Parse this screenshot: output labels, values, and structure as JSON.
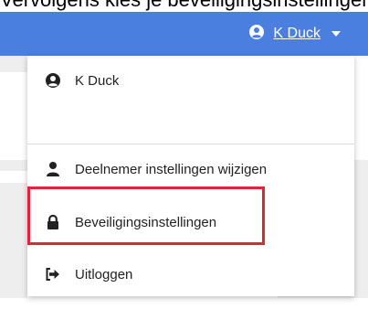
{
  "caption": "Vervolgens kies je beveiligingsinstellingen",
  "header": {
    "user_icon": "user-circle-icon",
    "user_name": "K Duck",
    "dropdown_icon": "caret-down-icon"
  },
  "menu": {
    "profile": {
      "icon": "user-circle-icon",
      "label": "K Duck"
    },
    "items": [
      {
        "icon": "user-icon",
        "label": "Deelnemer instellingen wijzigen"
      },
      {
        "icon": "lock-icon",
        "label": "Beveiligingsinstellingen"
      },
      {
        "icon": "sign-out-icon",
        "label": "Uitloggen"
      }
    ]
  },
  "colors": {
    "topbar": "#4a7fdf",
    "highlight": "#e32436"
  }
}
